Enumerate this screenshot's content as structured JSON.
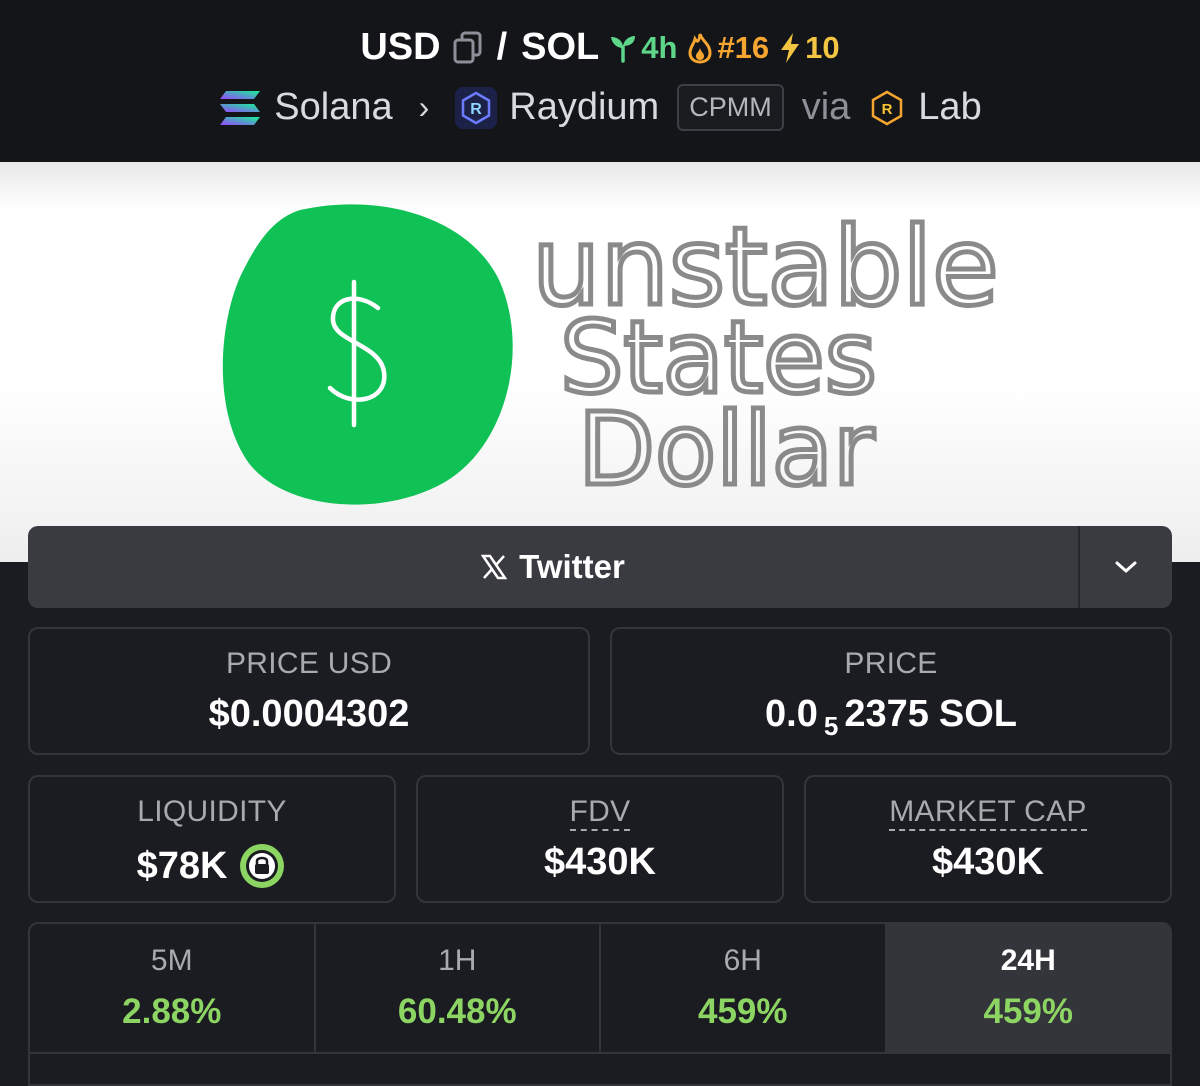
{
  "header": {
    "base_token": "USD",
    "separator": "/",
    "quote_token": "SOL",
    "age": "4h",
    "trending_rank": "#16",
    "boosts": "10",
    "chain": "Solana",
    "dex": "Raydium",
    "pool_type": "CPMM",
    "via_label": "via",
    "launchpad": "Lab"
  },
  "banner": {
    "line1": "unstable",
    "line2": "States",
    "line3": "Dollar",
    "coin_symbol": "$"
  },
  "socials": {
    "twitter_label": "Twitter"
  },
  "stats": {
    "price_usd_label": "PRICE USD",
    "price_usd_value": "$0.0004302",
    "price_label": "PRICE",
    "price_prefix": "0.0",
    "price_zero_count": "5",
    "price_digits": "2375",
    "price_unit": "SOL",
    "liquidity_label": "LIQUIDITY",
    "liquidity_value": "$78K",
    "fdv_label": "FDV",
    "fdv_value": "$430K",
    "mcap_label": "MARKET CAP",
    "mcap_value": "$430K"
  },
  "changes": [
    {
      "period": "5M",
      "pct": "2.88%"
    },
    {
      "period": "1H",
      "pct": "60.48%"
    },
    {
      "period": "6H",
      "pct": "459%"
    },
    {
      "period": "24H",
      "pct": "459%"
    }
  ],
  "colors": {
    "background": "#1b1c21",
    "header_bg": "#141518",
    "positive": "#8dd563",
    "age_green": "#5dd68a",
    "trend_orange": "#f7a531",
    "boost_yellow": "#f4c542",
    "coin_green": "#10c156"
  }
}
